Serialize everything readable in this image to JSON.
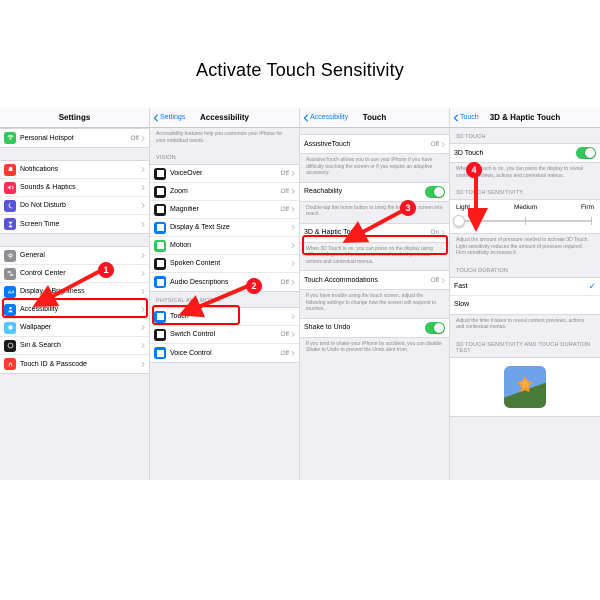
{
  "title": "Activate Touch Sensitivity",
  "panel1": {
    "nav_title": "Settings",
    "rows_a": [
      {
        "label": "Personal Hotspot",
        "value": "Off",
        "icon": "hotspot",
        "color": "#34c759"
      }
    ],
    "rows_b": [
      {
        "label": "Notifications",
        "icon": "bell",
        "color": "#ff3b30"
      },
      {
        "label": "Sounds & Haptics",
        "icon": "sound",
        "color": "#ff2d55"
      },
      {
        "label": "Do Not Disturb",
        "icon": "moon",
        "color": "#5856d6"
      },
      {
        "label": "Screen Time",
        "icon": "hourglass",
        "color": "#5856d6"
      }
    ],
    "rows_c": [
      {
        "label": "General",
        "icon": "gear",
        "color": "#8e8e93"
      },
      {
        "label": "Control Center",
        "icon": "switches",
        "color": "#8e8e93"
      },
      {
        "label": "Display & Brightness",
        "icon": "text",
        "color": "#007aff"
      },
      {
        "label": "Accessibility",
        "icon": "person",
        "color": "#007aff"
      },
      {
        "label": "Wallpaper",
        "icon": "flower",
        "color": "#54c7fc"
      },
      {
        "label": "Siri & Search",
        "icon": "siri",
        "color": "#1a1a1a"
      },
      {
        "label": "Touch ID & Passcode",
        "icon": "finger",
        "color": "#ff3b30"
      }
    ]
  },
  "panel2": {
    "back": "Settings",
    "nav_title": "Accessibility",
    "desc": "Accessibility features help you customize your iPhone for your individual needs.",
    "vision_header": "VISION",
    "vision_rows": [
      {
        "label": "VoiceOver",
        "value": "Off",
        "color": "#1a1a1a"
      },
      {
        "label": "Zoom",
        "value": "Off",
        "color": "#1a1a1a"
      },
      {
        "label": "Magnifier",
        "value": "Off",
        "color": "#1a1a1a"
      },
      {
        "label": "Display & Text Size",
        "value": "",
        "color": "#007aff"
      },
      {
        "label": "Motion",
        "value": "",
        "color": "#34c759"
      },
      {
        "label": "Spoken Content",
        "value": "",
        "color": "#1a1a1a"
      },
      {
        "label": "Audio Descriptions",
        "value": "Off",
        "color": "#007aff"
      }
    ],
    "motor_header": "PHYSICAL AND MOTOR",
    "motor_rows": [
      {
        "label": "Touch",
        "color": "#007aff"
      },
      {
        "label": "Switch Control",
        "value": "Off",
        "color": "#1a1a1a"
      },
      {
        "label": "Voice Control",
        "value": "Off",
        "color": "#007aff"
      }
    ]
  },
  "panel3": {
    "back": "Accessibility",
    "nav_title": "Touch",
    "assistive": {
      "label": "AssistiveTouch",
      "value": "Off"
    },
    "assistive_desc": "AssistiveTouch allows you to use your iPhone if you have difficulty touching the screen or if you require an adaptive accessory.",
    "reachability": {
      "label": "Reachability",
      "on": true
    },
    "reachability_desc": "Double-tap the home button to bring the top of the screen into reach.",
    "haptic": {
      "label": "3D & Haptic Touch",
      "value": "On"
    },
    "haptic_desc": "When 3D Touch is on, you can press on the display using different degrees of pressure to reveal content previews, actions and contextual menus.",
    "accom": {
      "label": "Touch Accommodations",
      "value": "Off"
    },
    "accom_desc": "If you have trouble using the touch screen, adjust the following settings to change how the screen will respond to touches.",
    "shake": {
      "label": "Shake to Undo",
      "on": true
    },
    "shake_desc": "If you tend to shake your iPhone by accident, you can disable Shake to Undo to prevent the Undo alert from"
  },
  "panel4": {
    "back": "Touch",
    "nav_title": "3D & Haptic Touch",
    "header1": "3D TOUCH",
    "toggle": {
      "label": "3D Touch",
      "on": true
    },
    "toggle_desc": "When 3D Touch is on, you can press the display to reveal content previews, actions and contextual menus.",
    "header2": "3D TOUCH SENSITIVITY",
    "seg": {
      "light": "Light",
      "medium": "Medium",
      "firm": "Firm"
    },
    "seg_desc": "Adjust the amount of pressure needed to activate 3D Touch. Light sensitivity reduces the amount of pressure required. Firm sensitivity increases it.",
    "header3": "TOUCH DURATION",
    "dur_rows": [
      {
        "label": "Fast",
        "checked": true
      },
      {
        "label": "Slow",
        "checked": false
      }
    ],
    "dur_desc": "Adjust the time it takes to reveal content previews, actions and contextual menus.",
    "header4": "3D TOUCH SENSITIVITY AND TOUCH DURATION TEST"
  },
  "callouts": {
    "c1": "1",
    "c2": "2",
    "c3": "3",
    "c4": "4"
  }
}
